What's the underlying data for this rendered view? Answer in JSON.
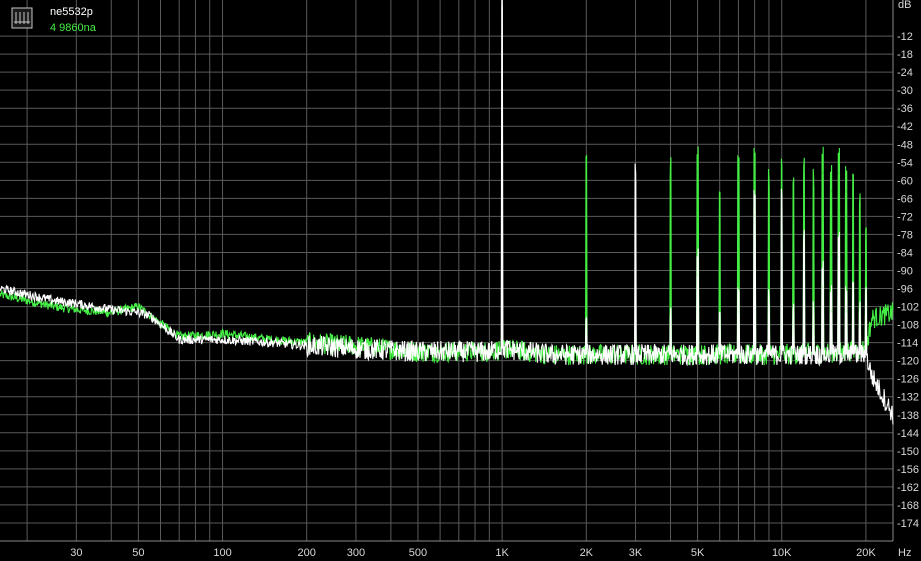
{
  "chart_data": {
    "type": "line",
    "title": "",
    "xlabel": "Hz",
    "ylabel": "dB",
    "x_scale": "log",
    "xlim": [
      16,
      25000
    ],
    "ylim": [
      -180,
      0
    ],
    "grid": true,
    "legend_position": "top-left",
    "x_ticks": [
      {
        "value": 30,
        "label": "30"
      },
      {
        "value": 50,
        "label": "50"
      },
      {
        "value": 100,
        "label": "100"
      },
      {
        "value": 200,
        "label": "200"
      },
      {
        "value": 300,
        "label": "300"
      },
      {
        "value": 500,
        "label": "500"
      },
      {
        "value": 1000,
        "label": "1K"
      },
      {
        "value": 2000,
        "label": "2K"
      },
      {
        "value": 3000,
        "label": "3K"
      },
      {
        "value": 5000,
        "label": "5K"
      },
      {
        "value": 10000,
        "label": "10K"
      },
      {
        "value": 20000,
        "label": "20K"
      }
    ],
    "y_ticks": [
      -12,
      -18,
      -24,
      -30,
      -36,
      -42,
      -48,
      -54,
      -60,
      -66,
      -72,
      -78,
      -84,
      -90,
      -96,
      -102,
      -108,
      -114,
      -120,
      -126,
      -132,
      -138,
      -144,
      -150,
      -156,
      -162,
      -168,
      -174
    ],
    "series": [
      {
        "name": "ne5532p",
        "color": "#ffffff",
        "noise_floor": [
          [
            16,
            -96
          ],
          [
            20,
            -98
          ],
          [
            25,
            -100
          ],
          [
            30,
            -101
          ],
          [
            40,
            -103
          ],
          [
            50,
            -104
          ],
          [
            55,
            -105
          ],
          [
            70,
            -113
          ],
          [
            100,
            -113
          ],
          [
            150,
            -114
          ],
          [
            200,
            -115
          ],
          [
            300,
            -116
          ],
          [
            500,
            -117
          ],
          [
            900,
            -117
          ],
          [
            1000,
            -116
          ],
          [
            1500,
            -118
          ],
          [
            3000,
            -118
          ],
          [
            5000,
            -118
          ],
          [
            10000,
            -118
          ],
          [
            17000,
            -118
          ],
          [
            20000,
            -118
          ],
          [
            21000,
            -125
          ],
          [
            25000,
            -138
          ]
        ],
        "peaks": [
          [
            1000,
            -2
          ],
          [
            2000,
            -110
          ],
          [
            3000,
            -60
          ],
          [
            4000,
            -108
          ],
          [
            5000,
            -92
          ],
          [
            6000,
            -108
          ],
          [
            7000,
            -104
          ],
          [
            8000,
            -72
          ],
          [
            9000,
            -102
          ],
          [
            10000,
            -68
          ],
          [
            11000,
            -106
          ],
          [
            12000,
            -82
          ],
          [
            13000,
            -106
          ],
          [
            14000,
            -96
          ],
          [
            15000,
            -104
          ],
          [
            16000,
            -86
          ],
          [
            17000,
            -104
          ],
          [
            18000,
            -98
          ],
          [
            19000,
            -106
          ],
          [
            20000,
            -100
          ]
        ]
      },
      {
        "name": "4 9860na",
        "color": "#44ee44",
        "noise_floor": [
          [
            16,
            -98
          ],
          [
            20,
            -100
          ],
          [
            25,
            -102
          ],
          [
            30,
            -103
          ],
          [
            40,
            -104
          ],
          [
            50,
            -102
          ],
          [
            55,
            -105
          ],
          [
            70,
            -112
          ],
          [
            100,
            -111
          ],
          [
            150,
            -113
          ],
          [
            200,
            -114
          ],
          [
            300,
            -115
          ],
          [
            500,
            -117
          ],
          [
            900,
            -117
          ],
          [
            1000,
            -116
          ],
          [
            1500,
            -118
          ],
          [
            3000,
            -118
          ],
          [
            5000,
            -118
          ],
          [
            10000,
            -118
          ],
          [
            17000,
            -117
          ],
          [
            20000,
            -116
          ],
          [
            21000,
            -106
          ],
          [
            25000,
            -104
          ]
        ],
        "peaks": [
          [
            2000,
            -56
          ],
          [
            3000,
            -108
          ],
          [
            4000,
            -58
          ],
          [
            5000,
            -58
          ],
          [
            6000,
            -68
          ],
          [
            7000,
            -60
          ],
          [
            8000,
            -58
          ],
          [
            9000,
            -62
          ],
          [
            10000,
            -58
          ],
          [
            11000,
            -64
          ],
          [
            12000,
            -58
          ],
          [
            13000,
            -62
          ],
          [
            14000,
            -58
          ],
          [
            15000,
            -64
          ],
          [
            16000,
            -58
          ],
          [
            17000,
            -64
          ],
          [
            18000,
            -62
          ],
          [
            19000,
            -70
          ],
          [
            20000,
            -80
          ]
        ]
      }
    ]
  }
}
